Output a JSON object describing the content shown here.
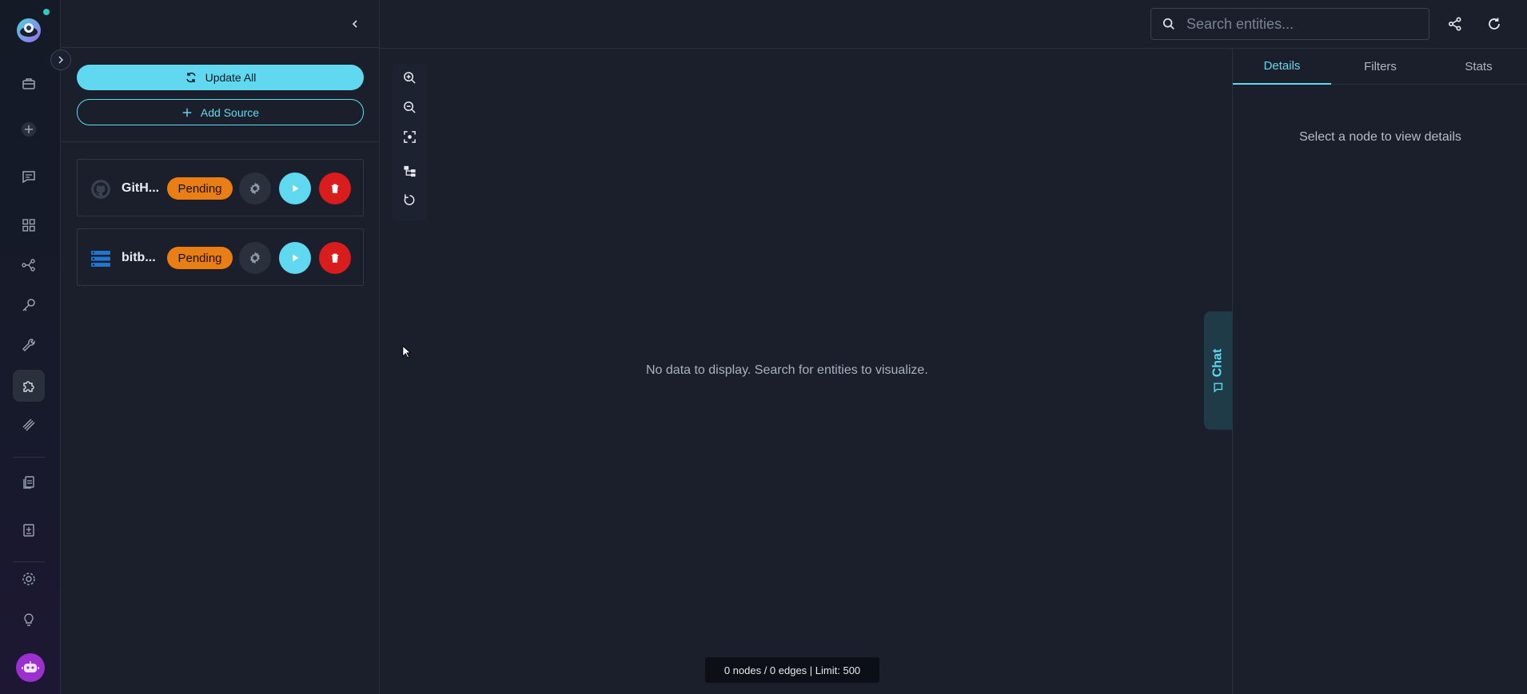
{
  "rail": {
    "items": [
      {
        "name": "briefcase-icon"
      },
      {
        "name": "plus-icon"
      },
      {
        "name": "chat-icon"
      },
      {
        "name": "dashboard-grid-icon"
      },
      {
        "name": "graph-network-icon"
      },
      {
        "name": "key-icon"
      },
      {
        "name": "wrench-icon"
      },
      {
        "name": "puzzle-icon",
        "active": true
      },
      {
        "name": "layers-icon"
      },
      {
        "name": "documents-icon"
      },
      {
        "name": "report-icon"
      },
      {
        "name": "settings-icon"
      },
      {
        "name": "lightbulb-icon"
      }
    ]
  },
  "sources": {
    "update_all_label": "Update All",
    "add_source_label": "Add Source",
    "items": [
      {
        "name": "GitH...",
        "status": "Pending",
        "icon": "github-icon"
      },
      {
        "name": "bitb...",
        "status": "Pending",
        "icon": "bitbucket-icon"
      }
    ]
  },
  "search": {
    "placeholder": "Search entities..."
  },
  "graph": {
    "empty_message": "No data to display. Search for entities to visualize.",
    "status_text": "0 nodes / 0 edges | Limit: 500",
    "chat_label": "Chat"
  },
  "details": {
    "tabs": [
      {
        "label": "Details",
        "active": true
      },
      {
        "label": "Filters"
      },
      {
        "label": "Stats"
      }
    ],
    "hint": "Select a node to view details"
  },
  "colors": {
    "accent": "#5fd8f0",
    "pending": "#e97e14",
    "danger": "#d91c1c",
    "background": "#1a1f2b"
  }
}
